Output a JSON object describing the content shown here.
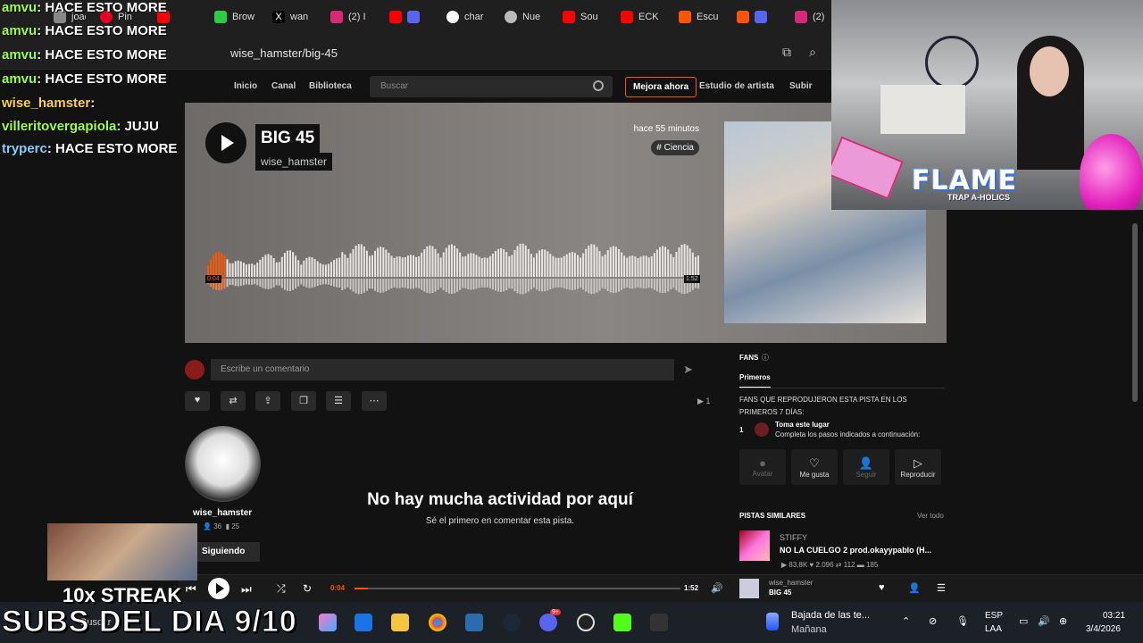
{
  "browser": {
    "tabs": [
      {
        "label": "joac",
        "icon": "avatar-icon",
        "color": "#888888"
      },
      {
        "label": "Pin",
        "icon": "pinterest-icon",
        "color": "#e60023"
      },
      {
        "label": "",
        "icon": "youtube-icon",
        "color": "#ff0000"
      },
      {
        "label": "Brow",
        "icon": "game-icon",
        "color": "#2ecc40"
      },
      {
        "label": "wan",
        "icon": "x-icon",
        "color": "#000000"
      },
      {
        "label": "(2) I",
        "icon": "instagram-icon",
        "color": "#d62976"
      },
      {
        "label": "",
        "icon": "youtube-icon",
        "color": "#ff0000"
      },
      {
        "label": "char",
        "icon": "google-icon",
        "color": "#ffffff"
      },
      {
        "label": "Nue",
        "icon": "chrome-icon",
        "color": "#bbbbbb"
      },
      {
        "label": "Sou",
        "icon": "youtube-icon",
        "color": "#ff0000"
      },
      {
        "label": "ECK",
        "icon": "youtube-icon",
        "color": "#ff0000"
      },
      {
        "label": "Escu",
        "icon": "soundcloud-icon",
        "color": "#ff5500"
      },
      {
        "label": "",
        "icon": "soundcloud-icon",
        "color": "#ff5500"
      },
      {
        "label": "(2)",
        "icon": "instagram-icon",
        "color": "#d62976"
      }
    ],
    "url": "wise_hamster/big-45"
  },
  "nav": {
    "links": [
      "Inicio",
      "Canal",
      "Biblioteca"
    ],
    "search_placeholder": "Buscar",
    "upgrade": "Mejora ahora",
    "studio": "Estudio de artista",
    "upload": "Subir"
  },
  "track": {
    "title": "BIG 45",
    "artist": "wise_hamster",
    "ago": "hace 55 minutos",
    "tag": "# Ciencia",
    "time_current": "0:04",
    "time_total": "1:52",
    "progress": 0.04
  },
  "comment": {
    "placeholder": "Escribe un comentario",
    "plays": "1"
  },
  "profile": {
    "name": "wise_hamster",
    "followers": "36",
    "tracks": "25",
    "following_label": "Siguiendo"
  },
  "empty": {
    "heading": "No hay mucha actividad por aquí",
    "sub": "Sé el primero en comentar esta pista."
  },
  "fans": {
    "title": "FANS",
    "tab": "Primeros",
    "desc": "FANS QUE REPRODUJERON ESTA PISTA EN LOS PRIMEROS 7 DÍAS:",
    "rank": "1",
    "place_title": "Toma este lugar",
    "place_sub": "Completa los pasos indicados a continuación:",
    "buttons": [
      "Avatar",
      "Me gusta",
      "Seguir",
      "Reproducir"
    ]
  },
  "similar": {
    "title": "PISTAS SIMILARES",
    "view_all": "Ver todo",
    "artist": "STIFFY",
    "track": "NO LA CUELGO 2 prod.okayypablo (H...",
    "plays": "83,8K",
    "likes": "2.096",
    "reposts": "112",
    "comments": "185"
  },
  "player": {
    "current": "0:04",
    "total": "1:52",
    "artist": "wise_hamster",
    "track": "BIG 45"
  },
  "taskbar": {
    "search": "Buscar",
    "weather_title": "Bajada de las te...",
    "weather_sub": "Mañana",
    "lang": "ESP",
    "lang_sub": "LAA",
    "time": "03:21",
    "date": "3/4/2026",
    "discord_badge": "9+"
  },
  "overlay": {
    "chat": [
      {
        "user": "amvu",
        "msg": ": HACE ESTO MORE"
      },
      {
        "user": "amvu",
        "msg": ": HACE ESTO MORE"
      },
      {
        "user": "amvu",
        "msg": ": HACE ESTO MORE"
      },
      {
        "user": "amvu",
        "msg": ": HACE ESTO MORE"
      },
      {
        "user": "wise_hamster",
        "msg": ":"
      },
      {
        "user": "villeritovergapiola",
        "msg": ": JUJU"
      },
      {
        "user": "tryperc",
        "msg": ": HACE ESTO MORE"
      }
    ],
    "flame": "FLAME",
    "flame_sub": "TRAP A-HOLICS",
    "streak": "10x STREAK",
    "subs": "SUBS DEL DIA 9/10"
  }
}
